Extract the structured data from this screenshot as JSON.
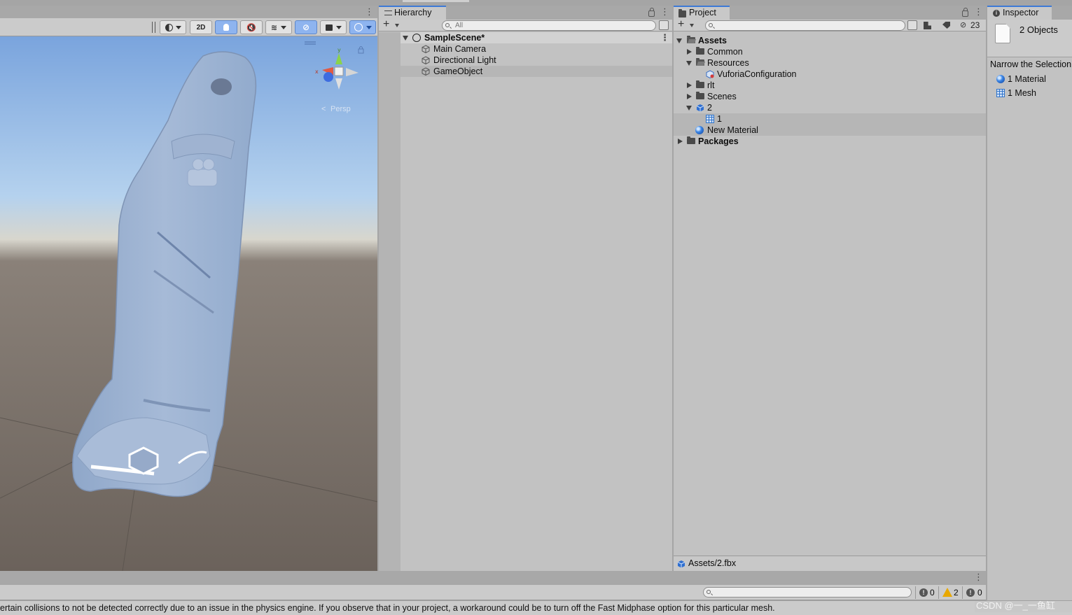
{
  "scene_toolbar": {
    "btn_2d": "2D"
  },
  "scene_view": {
    "projection_label": "Persp",
    "gizmo_axes": {
      "y": "y",
      "x": "x"
    }
  },
  "hierarchy": {
    "tab_label": "Hierarchy",
    "search_placeholder": "All",
    "scene_name": "SampleScene*",
    "items": [
      "Main Camera",
      "Directional Light",
      "GameObject"
    ]
  },
  "project": {
    "tab_label": "Project",
    "badge_count": "23",
    "tree": {
      "assets": "Assets",
      "common": "Common",
      "resources": "Resources",
      "vuforia_config": "VuforiaConfiguration",
      "rlt": "rlt",
      "scenes": "Scenes",
      "model": "2",
      "mesh": "1",
      "material": "New Material",
      "packages": "Packages"
    },
    "footer_path": "Assets/2.fbx"
  },
  "inspector": {
    "tab_label": "Inspector",
    "selection_count": "2 Objects",
    "narrow_heading": "Narrow the Selection",
    "narrow_items": [
      "1 Material",
      "1 Mesh"
    ]
  },
  "console": {
    "search_placeholder": "",
    "info_count": "0",
    "warning_count": "2",
    "error_count": "0",
    "status_message": "ertain collisions to not be detected correctly due to an issue in the physics engine. If you observe that in your project, a workaround could be to turn off the Fast Midphase option for this particular mesh.",
    "watermark": "CSDN @一_一鱼缸"
  },
  "colors": {
    "accent": "#3d7ad6",
    "panel_bg": "#c2c2c2",
    "selected_row": "#b6b6b6",
    "toolbar_active": "#8eb4ef"
  }
}
